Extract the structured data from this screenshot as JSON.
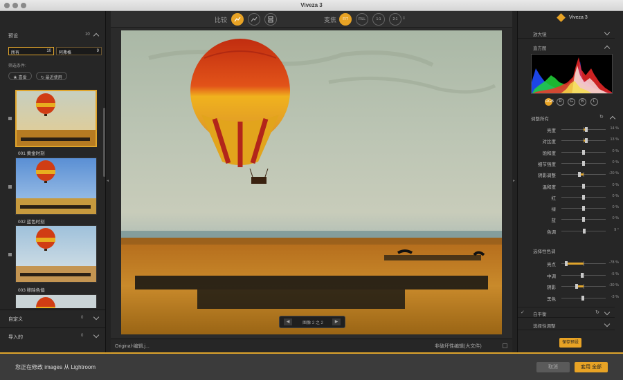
{
  "window": {
    "title": "Viveza 3"
  },
  "left": {
    "presets_label": "预设",
    "presets_count": "10",
    "filter_all": {
      "label": "所有",
      "count": "10"
    },
    "filter_ajar": {
      "label": "阿弗格",
      "count": "9"
    },
    "filter_condition_label": "筛选条件:",
    "pill_favorite": "★ 喜爱",
    "pill_recent": "↻ 最近使用",
    "thumbs": [
      {
        "label": "001 黄金时刻"
      },
      {
        "label": "002 蓝色时刻"
      },
      {
        "label": "003 移除色偏"
      }
    ],
    "custom_label": "自定义",
    "custom_count": "0",
    "imported_label": "导入的",
    "imported_count": "0"
  },
  "toolbar": {
    "compare_label": "比较",
    "zoom_label": "变焦",
    "fit": "FIT",
    "fill": "FILL",
    "one_to_one": "1:1",
    "two_to_one": "2:1"
  },
  "canvas": {
    "nav_text": "图像 2 之 2",
    "footer_left": "Original-编辑.j...",
    "footer_right": "非破坏性编辑(大文件)"
  },
  "right": {
    "brand": "Viveza 3",
    "loupe": "放大镜",
    "histogram": "直方图",
    "channels": [
      "RGB",
      "R",
      "G",
      "B",
      "L"
    ],
    "adjust_all": "调整所有",
    "sliders": [
      {
        "label": "亮度",
        "value": "14 %",
        "pos": 0.57
      },
      {
        "label": "对比度",
        "value": "13 %",
        "pos": 0.565
      },
      {
        "label": "饱和度",
        "value": "0 %",
        "pos": 0.5
      },
      {
        "label": "细节强度",
        "value": "0 %",
        "pos": 0.5
      },
      {
        "label": "阴影调整",
        "value": "-20 %",
        "pos": 0.4
      },
      {
        "label": "温和度",
        "value": "0 %",
        "pos": 0.5
      },
      {
        "label": "红",
        "value": "0 %",
        "pos": 0.5
      },
      {
        "label": "绿",
        "value": "0 %",
        "pos": 0.5
      },
      {
        "label": "蓝",
        "value": "0 %",
        "pos": 0.5
      },
      {
        "label": "色调",
        "value": "9 °",
        "pos": 0.52
      }
    ],
    "selective_tone": "选择性色调",
    "tone_sliders": [
      {
        "label": "亮点",
        "value": "-78 %",
        "pos": 0.11
      },
      {
        "label": "中调",
        "value": "-5 %",
        "pos": 0.475
      },
      {
        "label": "阴影",
        "value": "-30 %",
        "pos": 0.35
      },
      {
        "label": "黑色",
        "value": "-3 %",
        "pos": 0.485
      }
    ],
    "white_balance": "白平衡",
    "selective_adjust": "选择性调整",
    "save_preset": "保存预设"
  },
  "bottom": {
    "message": "您正在修改 images 从 Lightroom",
    "cancel": "取消",
    "apply": "套用 全部"
  },
  "colors": {
    "accent": "#e8a325"
  }
}
